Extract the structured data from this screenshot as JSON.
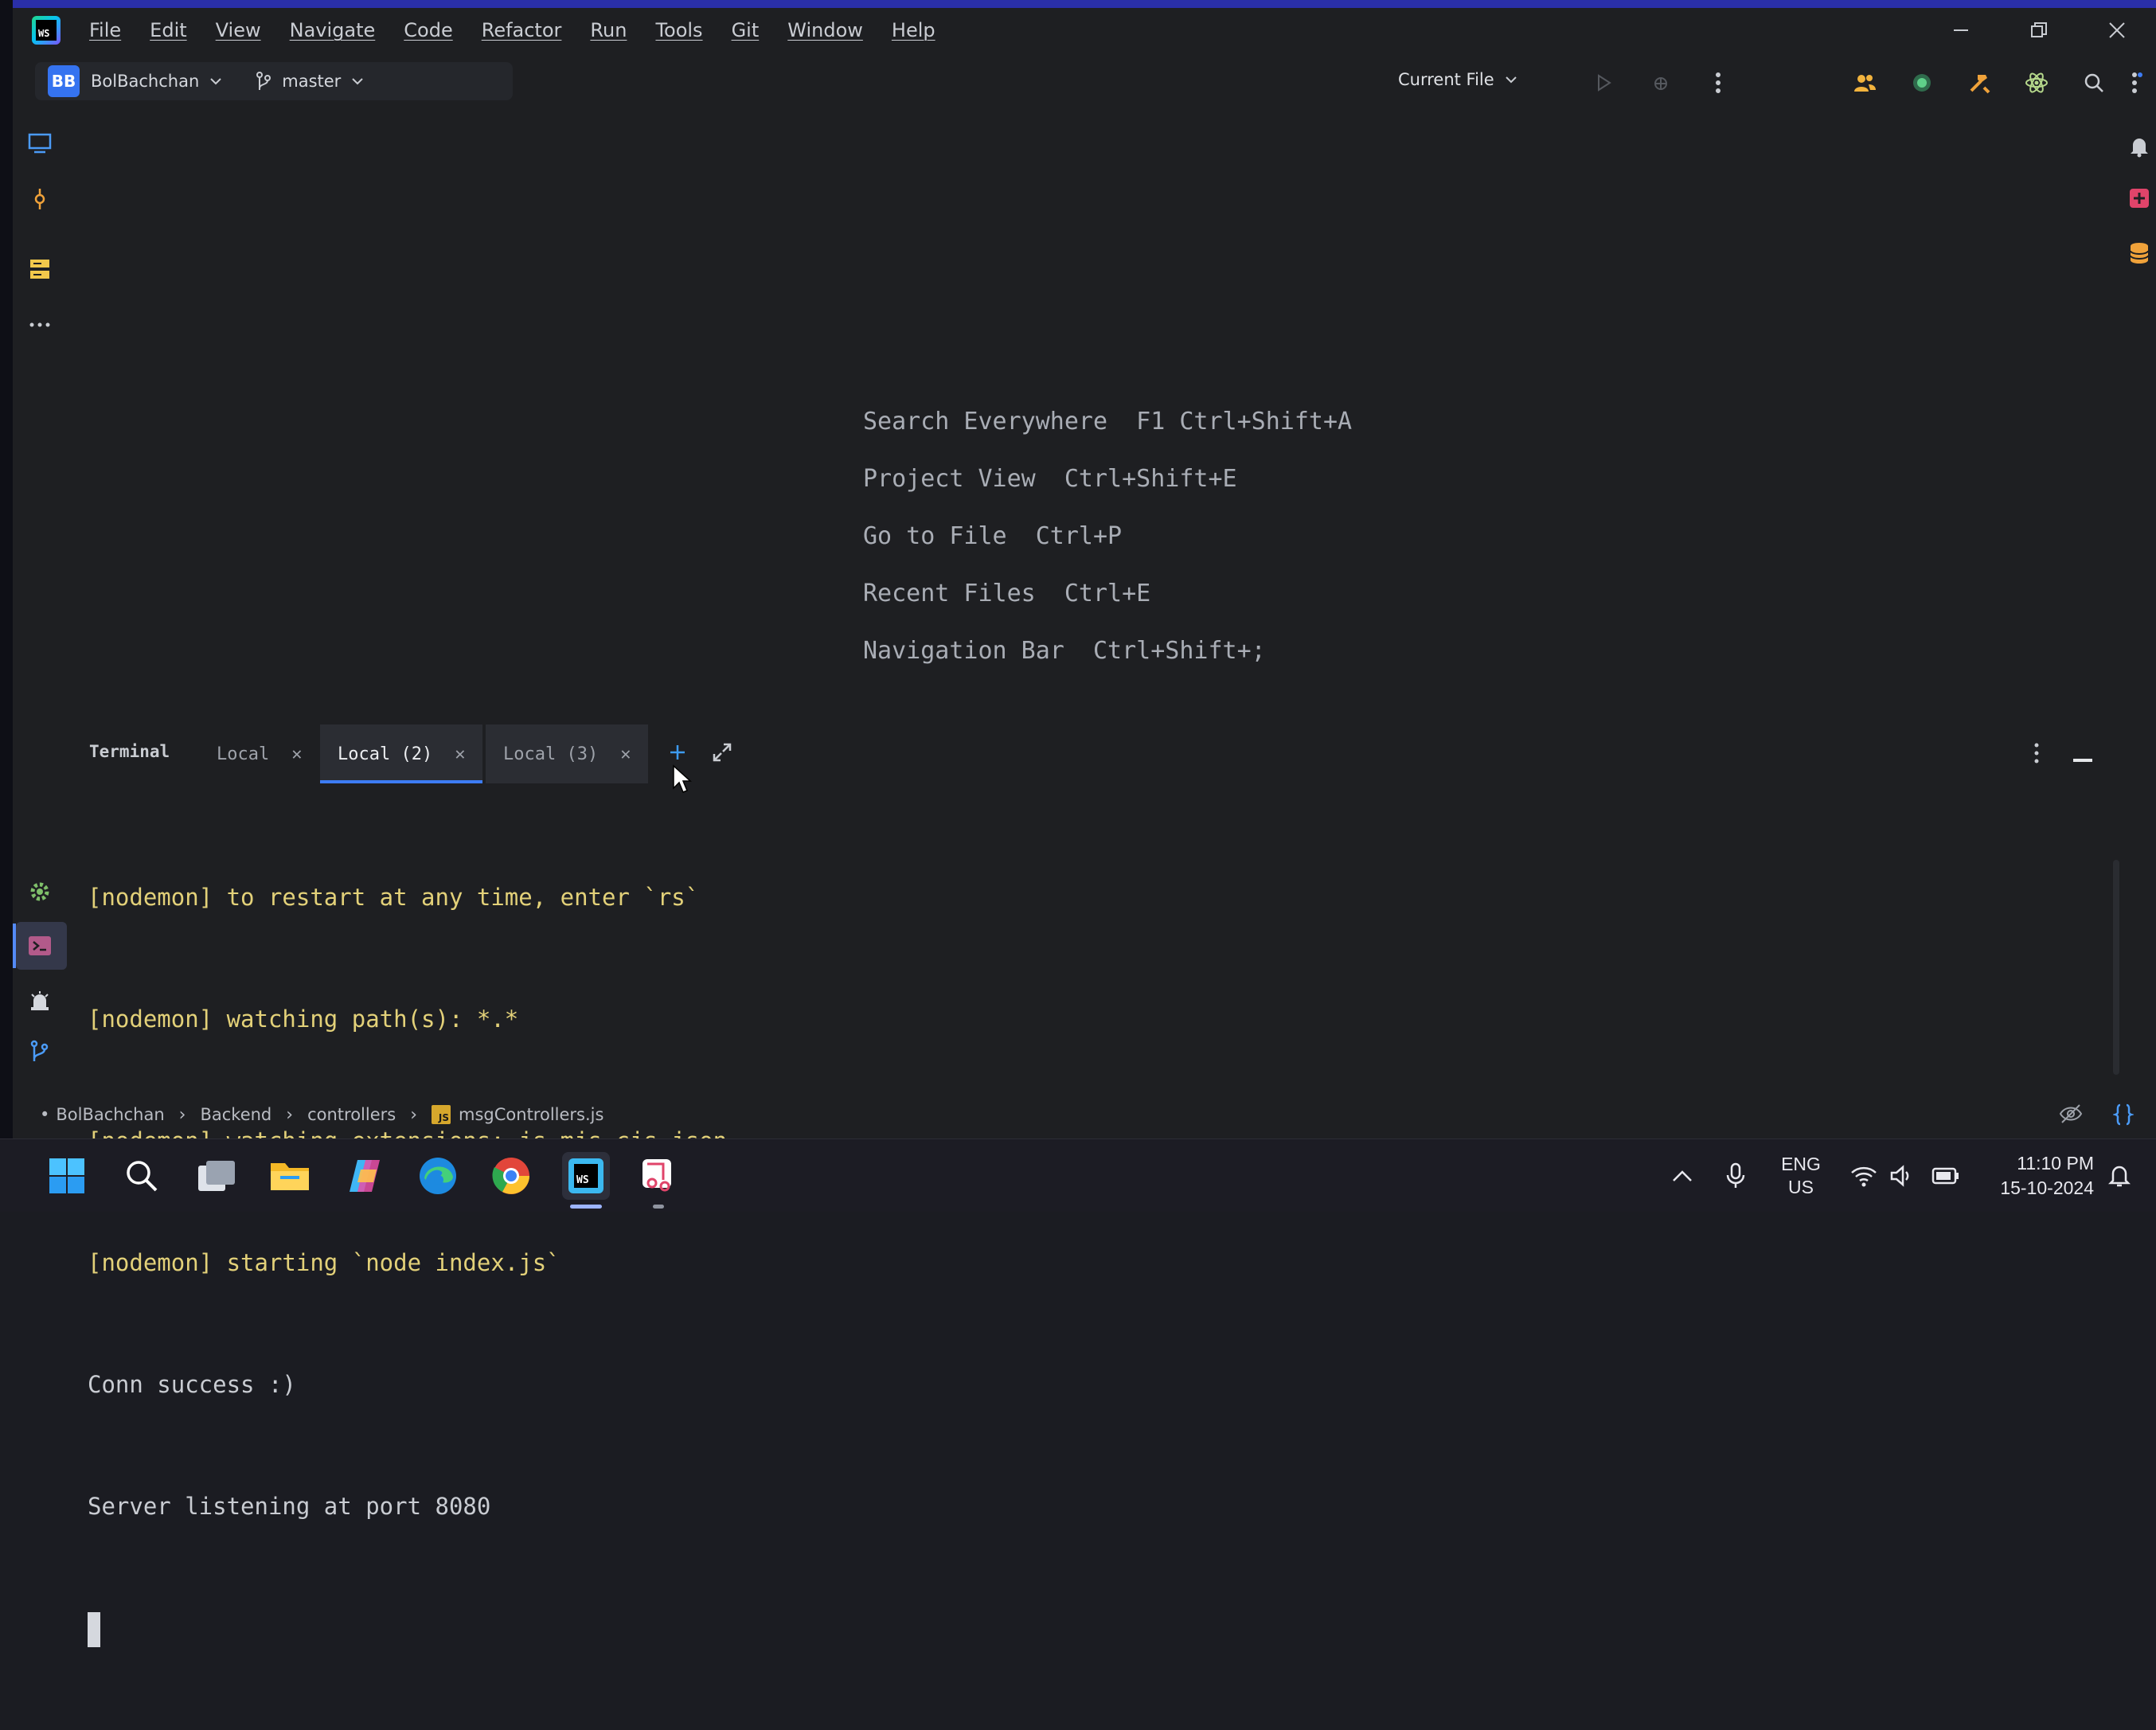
{
  "app": {
    "logo_text": "WS",
    "menu": [
      "File",
      "Edit",
      "View",
      "Navigate",
      "Code",
      "Refactor",
      "Run",
      "Tools",
      "Git",
      "Window",
      "Help"
    ]
  },
  "toolbar": {
    "project_initials": "BB",
    "project_name": "BolBachchan",
    "branch": "master",
    "run_config": "Current File"
  },
  "editor": {
    "hints": [
      {
        "label": "Search Everywhere",
        "shortcut": "F1 Ctrl+Shift+A"
      },
      {
        "label": "Project View",
        "shortcut": "Ctrl+Shift+E"
      },
      {
        "label": "Go to File",
        "shortcut": "Ctrl+P"
      },
      {
        "label": "Recent Files",
        "shortcut": "Ctrl+E"
      },
      {
        "label": "Navigation Bar",
        "shortcut": "Ctrl+Shift+;"
      }
    ]
  },
  "terminal": {
    "title": "Terminal",
    "tabs": [
      {
        "label": "Local",
        "active": false
      },
      {
        "label": "Local (2)",
        "active": true
      },
      {
        "label": "Local (3)",
        "active": false
      }
    ],
    "lines": [
      "[nodemon] to restart at any time, enter `rs`",
      "[nodemon] watching path(s): *.*",
      "[nodemon] watching extensions: js,mjs,cjs,json",
      "[nodemon] starting `node index.js`",
      "Conn success :)",
      "Server listening at port 8080"
    ]
  },
  "breadcrumb": {
    "items": [
      "BolBachchan",
      "Backend",
      "controllers",
      "msgControllers.js"
    ],
    "file_badge": "JS"
  },
  "taskbar": {
    "lang_top": "ENG",
    "lang_bottom": "US",
    "time": "11:10 PM",
    "date": "15-10-2024"
  },
  "colors": {
    "accent": "#3d7cf5",
    "nodemon_text": "#e3d179",
    "ide_bg": "#1e1f22"
  }
}
